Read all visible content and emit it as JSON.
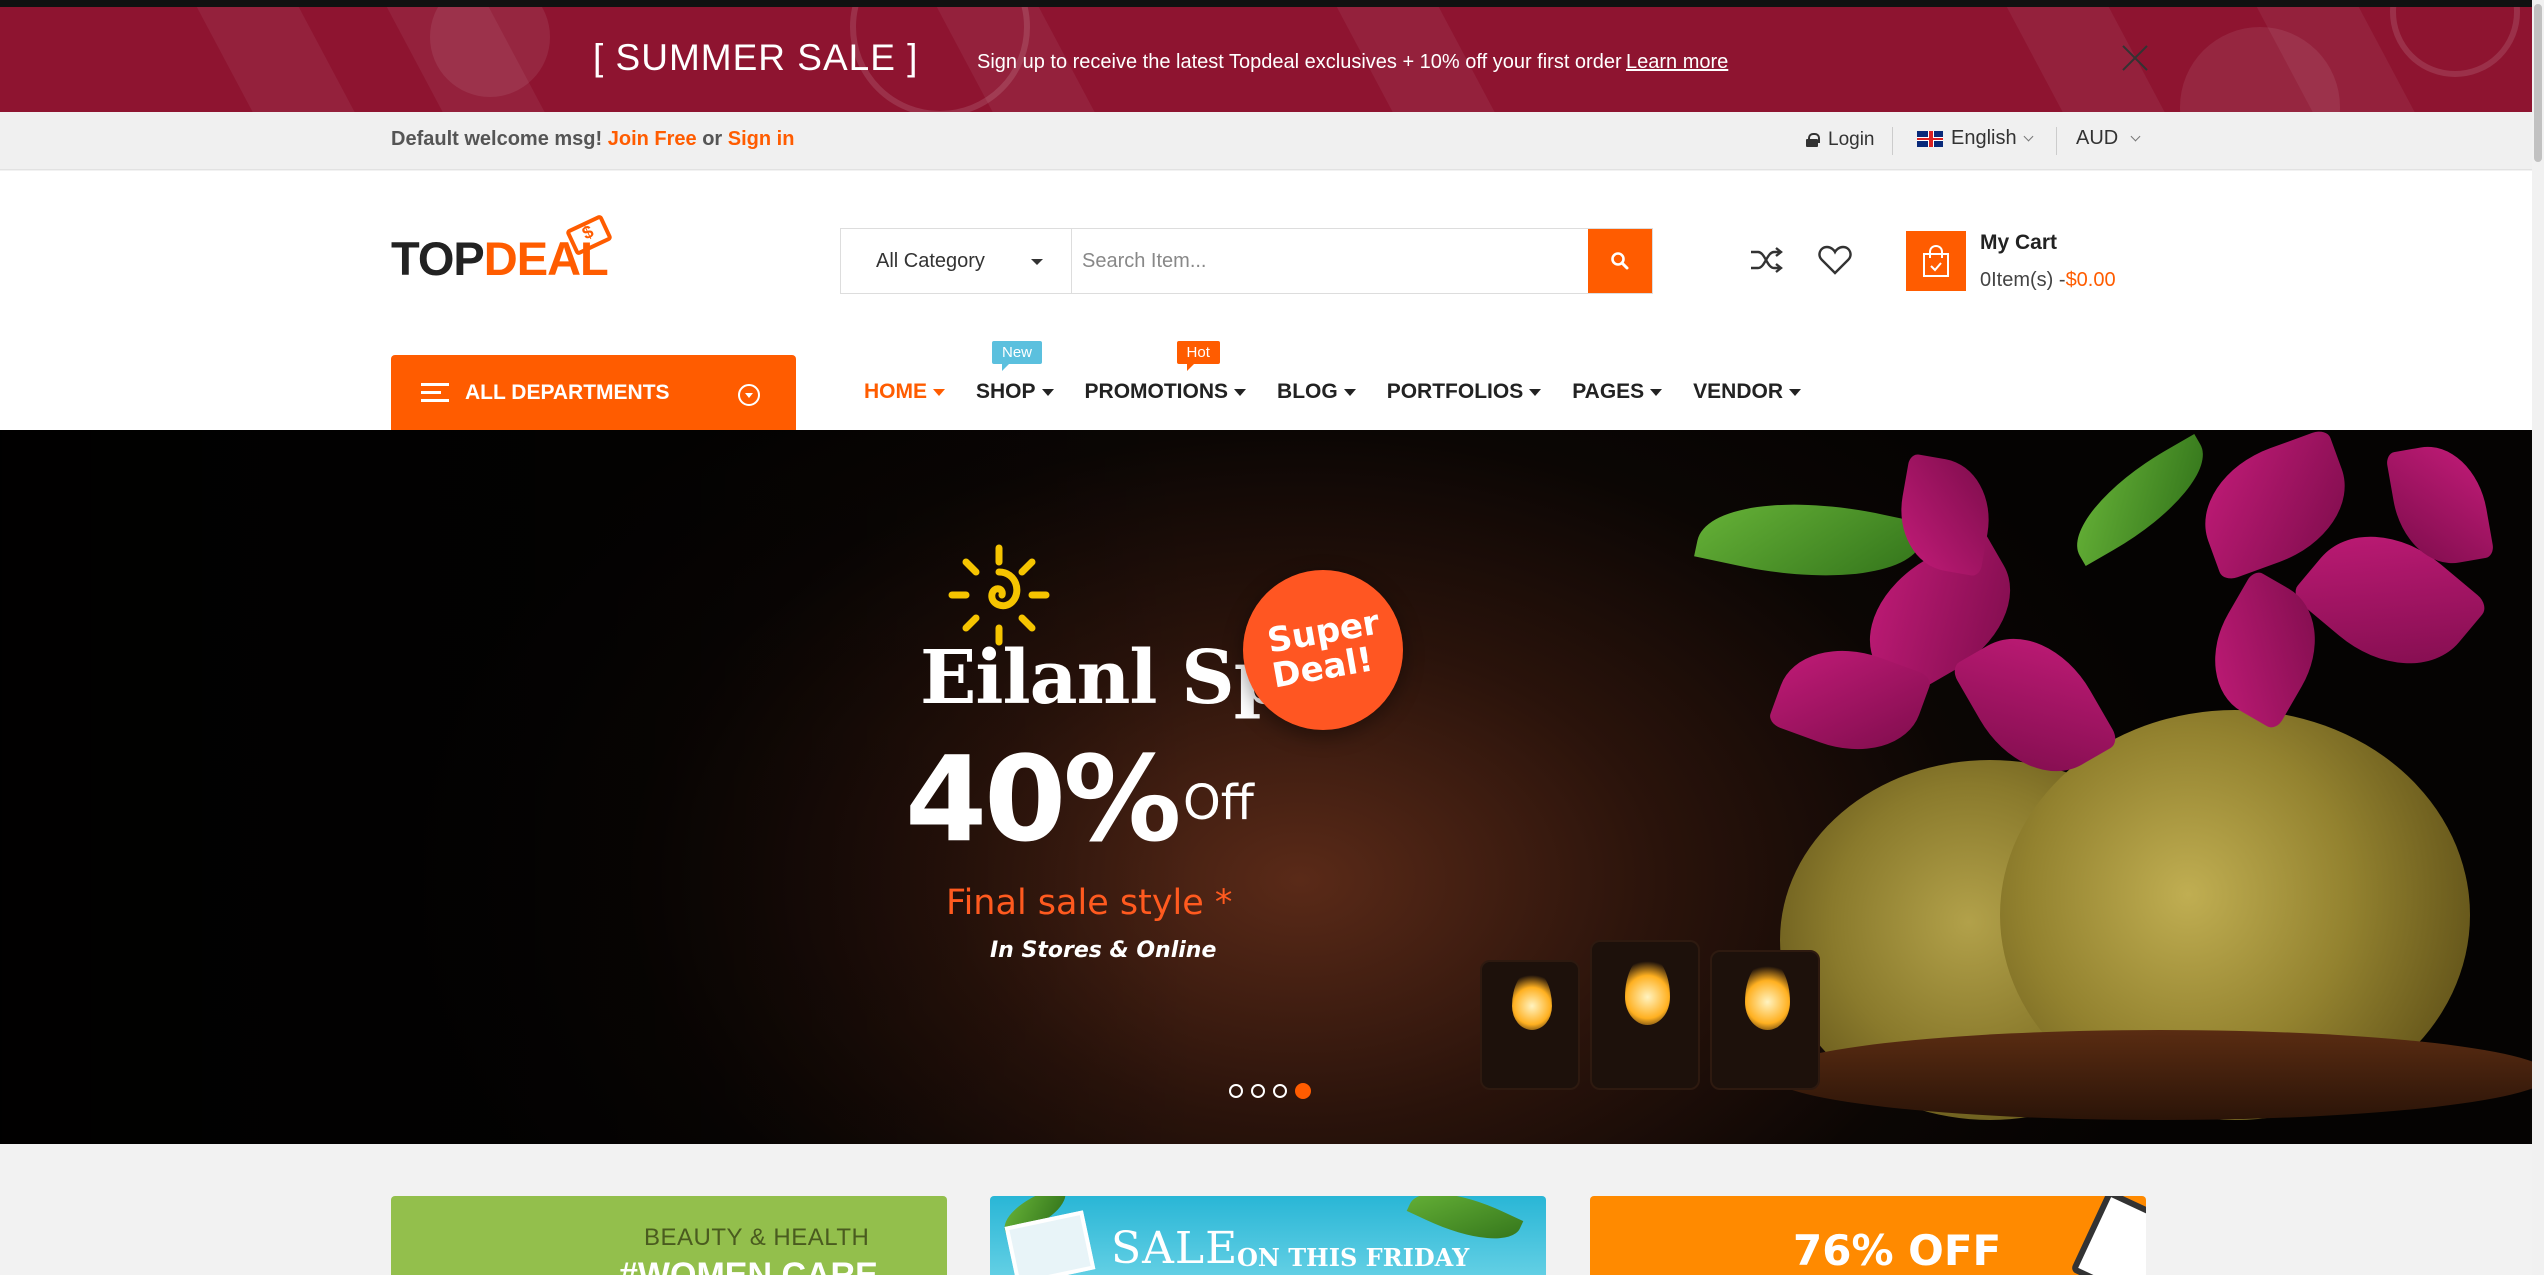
{
  "promo": {
    "title": "[ SUMMER SALE ]",
    "text": "Sign up to receive the latest Topdeal exclusives + 10% off your first order",
    "link": "Learn more"
  },
  "topbar": {
    "welcome": "Default welcome msg!",
    "join": "Join Free",
    "or": "or",
    "signin": "Sign in",
    "login": "Login",
    "language": "English",
    "currency": "AUD"
  },
  "header": {
    "logo_top": "TOP",
    "logo_deal": "DEAL",
    "search_category": "All Category",
    "search_placeholder": "Search Item...",
    "cart_title": "My Cart",
    "cart_items": "0Item(s) -",
    "cart_price": "$0.00"
  },
  "nav": {
    "departments": "ALL DEPARTMENTS",
    "items": [
      {
        "label": "HOME"
      },
      {
        "label": "SHOP",
        "badge": "New"
      },
      {
        "label": "PROMOTIONS",
        "badge": "Hot"
      },
      {
        "label": "BLOG"
      },
      {
        "label": "PORTFOLIOS"
      },
      {
        "label": "PAGES"
      },
      {
        "label": "VENDOR"
      }
    ]
  },
  "hero": {
    "brand": "Eilanl Spa",
    "deal_line1": "Super",
    "deal_line2": "Deal!",
    "percent": "40%",
    "off": "Off",
    "subtitle": "Final sale style *",
    "tagline": "In Stores & Online",
    "slide_count": 4,
    "active_slide": 4
  },
  "cards": {
    "card1_small": "BEAUTY & HEALTH",
    "card1_big": "#WOMEN CARE",
    "card2_big": "SALE",
    "card2_small": "ON THIS FRIDAY",
    "card3_big": "76% OFF"
  },
  "colors": {
    "accent": "#ff5c00",
    "promo_bg": "#8e1430",
    "new_badge": "#5bc0de"
  }
}
